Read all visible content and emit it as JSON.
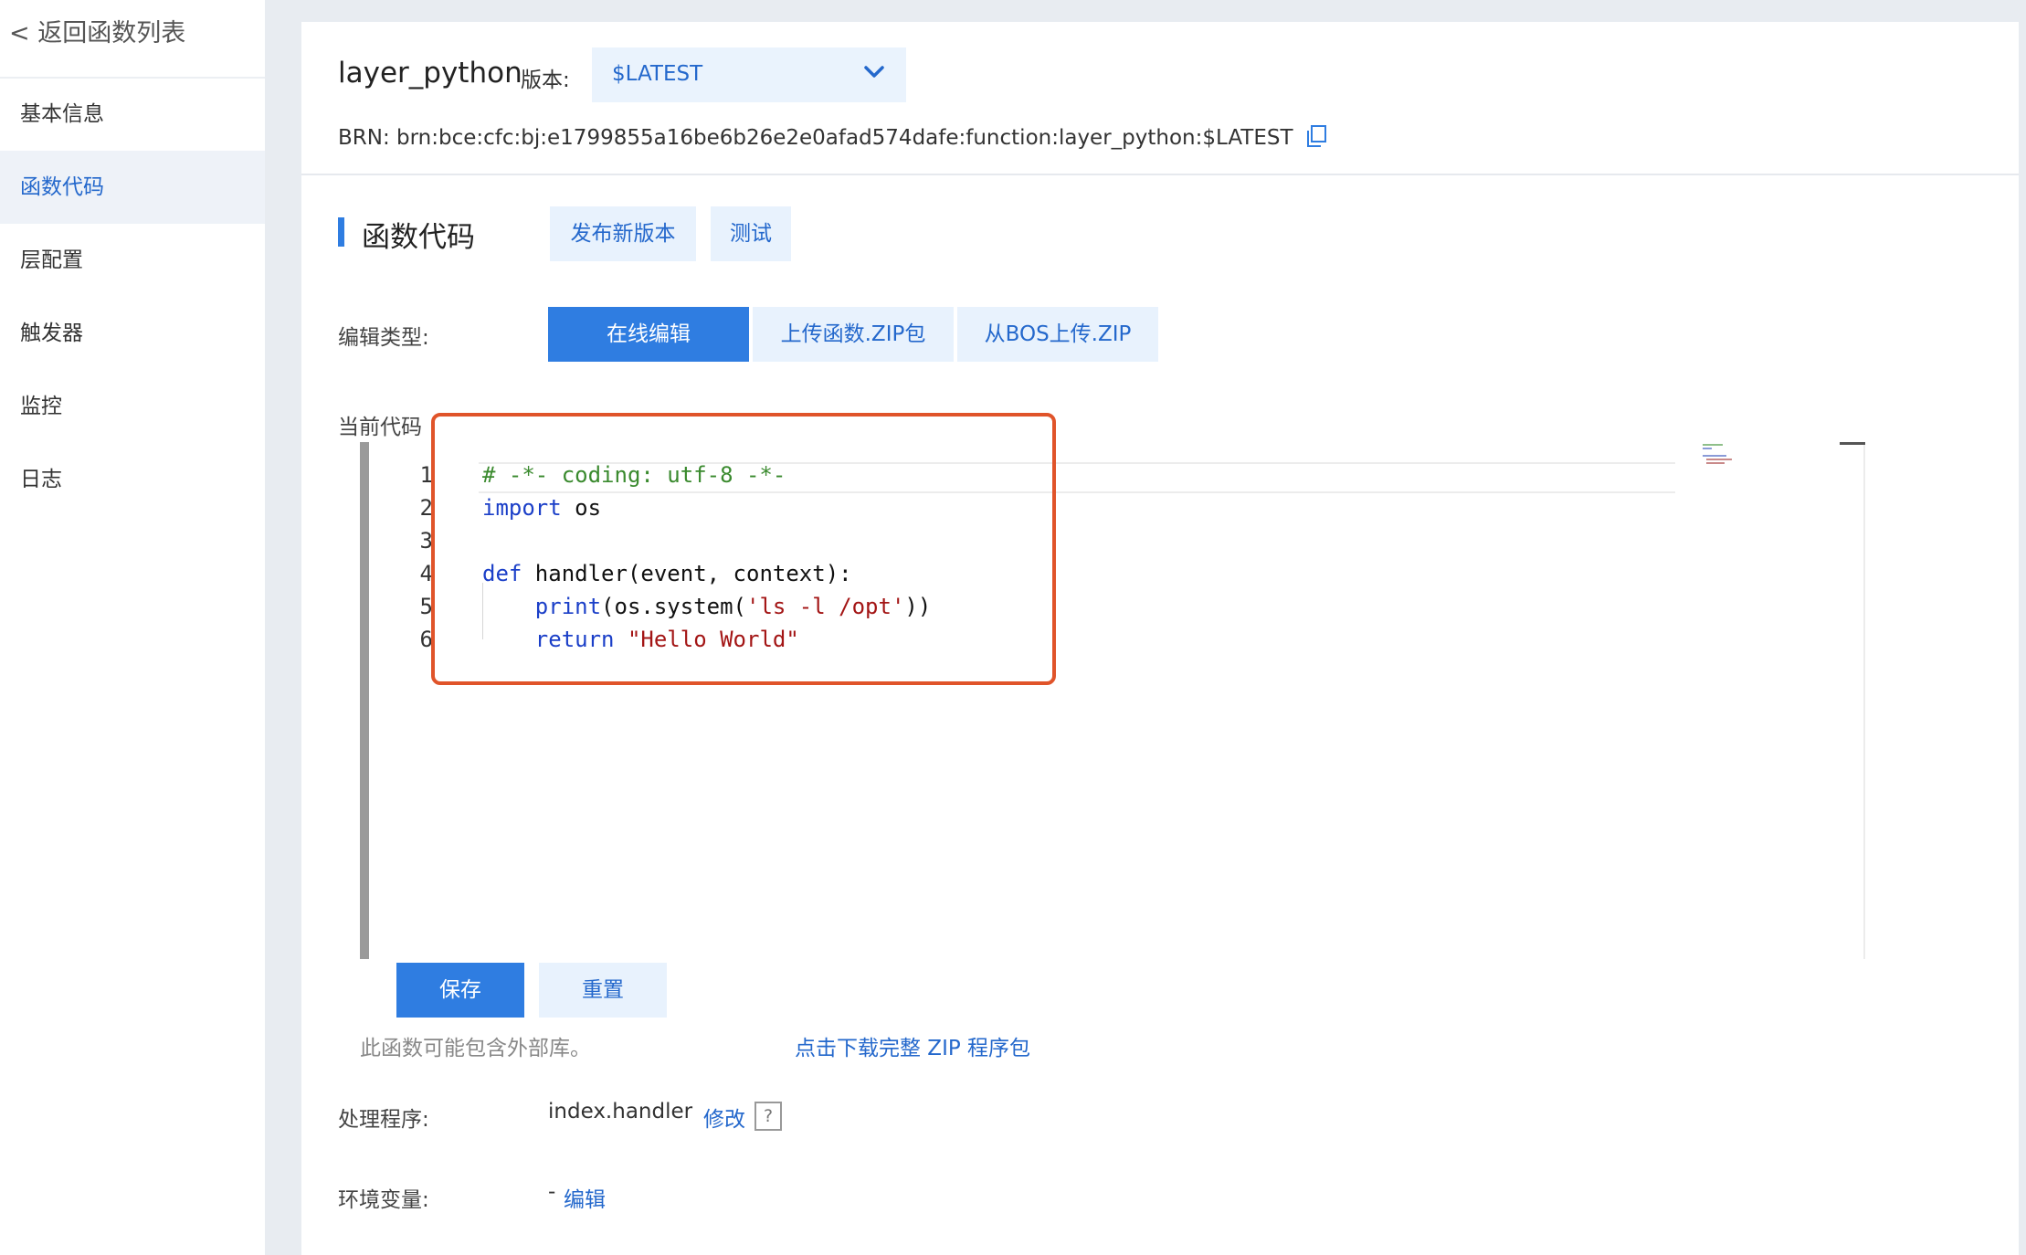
{
  "sidebar": {
    "back_label": "< 返回函数列表",
    "items": [
      {
        "label": "基本信息"
      },
      {
        "label": "函数代码"
      },
      {
        "label": "层配置"
      },
      {
        "label": "触发器"
      },
      {
        "label": "监控"
      },
      {
        "label": "日志"
      }
    ],
    "active_index": 1
  },
  "header": {
    "function_name": "layer_python",
    "version_label": "版本:",
    "version_value": "$LATEST",
    "brn_text": "BRN: brn:bce:cfc:bj:e1799855a16be6b26e2e0afad574dafe:function:layer_python:$LATEST"
  },
  "section": {
    "title": "函数代码",
    "publish_button": "发布新版本",
    "test_button": "测试"
  },
  "edit_type": {
    "label": "编辑类型:",
    "options": [
      "在线编辑",
      "上传函数.ZIP包",
      "从BOS上传.ZIP"
    ],
    "selected_index": 0
  },
  "code": {
    "label": "当前代码",
    "line_numbers": [
      "1",
      "2",
      "3",
      "4",
      "5",
      "6"
    ],
    "lines": [
      "# -*- coding: utf-8 -*-",
      "import os",
      "",
      "def handler(event, context):",
      "    print(os.system('ls -l /opt'))",
      "    return \"Hello World\""
    ]
  },
  "actions": {
    "save": "保存",
    "reset": "重置"
  },
  "note": "此函数可能包含外部库。",
  "download_link": "点击下载完整 ZIP 程序包",
  "handler": {
    "label": "处理程序:",
    "value": "index.handler",
    "edit_link": "修改",
    "help_icon": "?"
  },
  "env": {
    "label": "环境变量:",
    "value": "-",
    "edit_link": "编辑"
  },
  "colors": {
    "accent": "#2f7de1",
    "highlight_box": "#e0542a"
  }
}
